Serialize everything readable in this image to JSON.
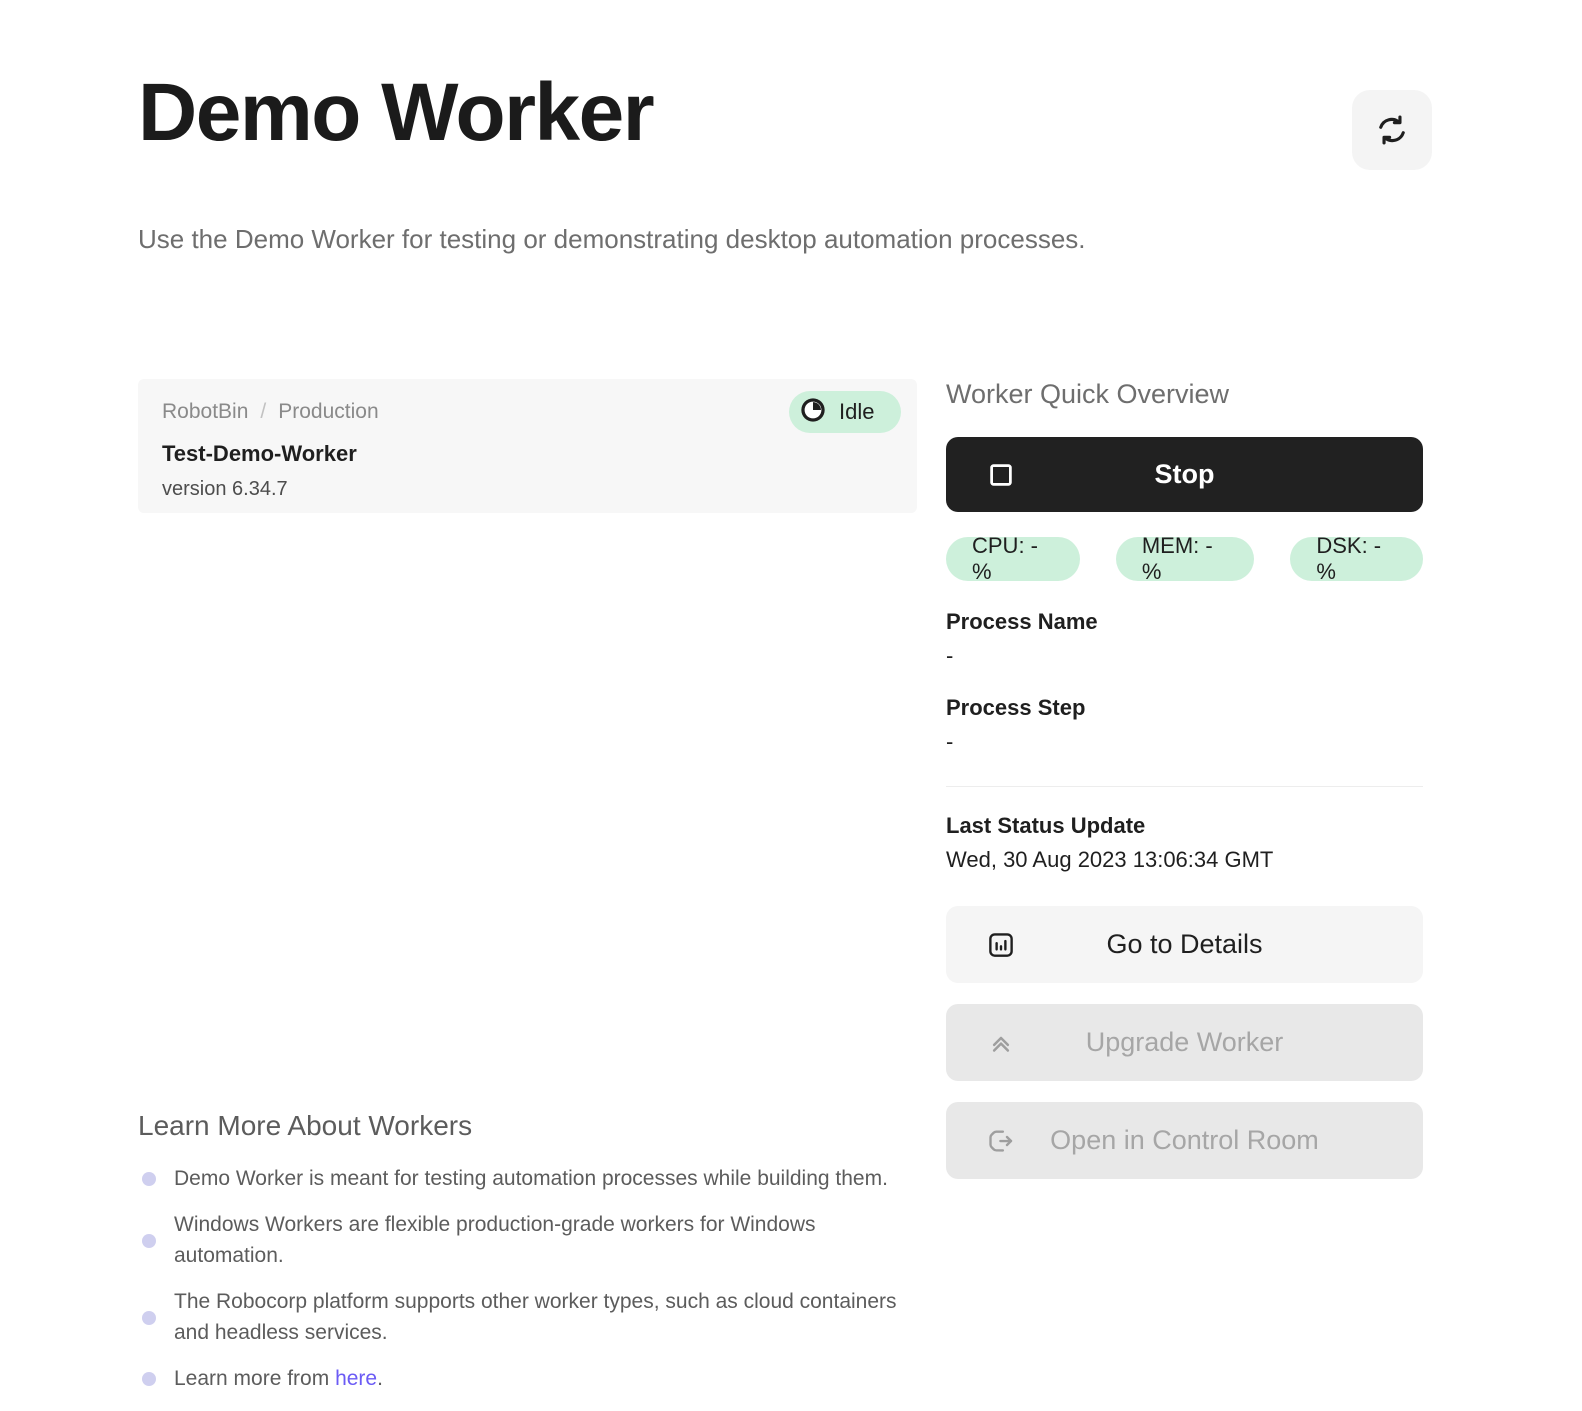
{
  "header": {
    "title": "Demo Worker",
    "subtitle": "Use the Demo Worker for testing or demonstrating desktop automation processes.",
    "refresh_icon": "refresh-icon"
  },
  "worker_card": {
    "breadcrumb": {
      "organization": "RobotBin",
      "separator": "/",
      "environment": "Production"
    },
    "name": "Test-Demo-Worker",
    "version": "version 6.34.7",
    "status": {
      "label": "Idle",
      "icon": "clock-icon",
      "background": "#cdf0db"
    }
  },
  "overview": {
    "title": "Worker Quick Overview",
    "stop_button": {
      "label": "Stop",
      "icon": "stop-square-icon",
      "background": "#212121"
    },
    "metrics": [
      {
        "label": "CPU: -%",
        "name": "cpu"
      },
      {
        "label": "MEM: -%",
        "name": "mem"
      },
      {
        "label": "DSK: -%",
        "name": "dsk"
      }
    ],
    "fields": [
      {
        "label": "Process Name",
        "value": "-"
      },
      {
        "label": "Process Step",
        "value": "-"
      }
    ],
    "last_status_update": {
      "label": "Last Status Update",
      "value": "Wed, 30 Aug 2023 13:06:34 GMT"
    },
    "actions": [
      {
        "label": "Go to Details",
        "icon": "bar-chart-icon",
        "disabled": false
      },
      {
        "label": "Upgrade Worker",
        "icon": "double-chevron-up-icon",
        "disabled": true
      },
      {
        "label": "Open in Control Room",
        "icon": "exit-arrow-icon",
        "disabled": true
      }
    ]
  },
  "learn_more": {
    "title": "Learn More About Workers",
    "items": [
      "Demo Worker is meant for testing automation processes while building them.",
      "Windows Workers are flexible production-grade workers for Windows automation.",
      "The Robocorp platform supports other worker types, such as cloud containers and headless services.",
      "Learn more from "
    ],
    "link_text": "here",
    "link_suffix": ".",
    "link_color": "#6b5bf5",
    "bullet_color": "#cfcfef"
  }
}
